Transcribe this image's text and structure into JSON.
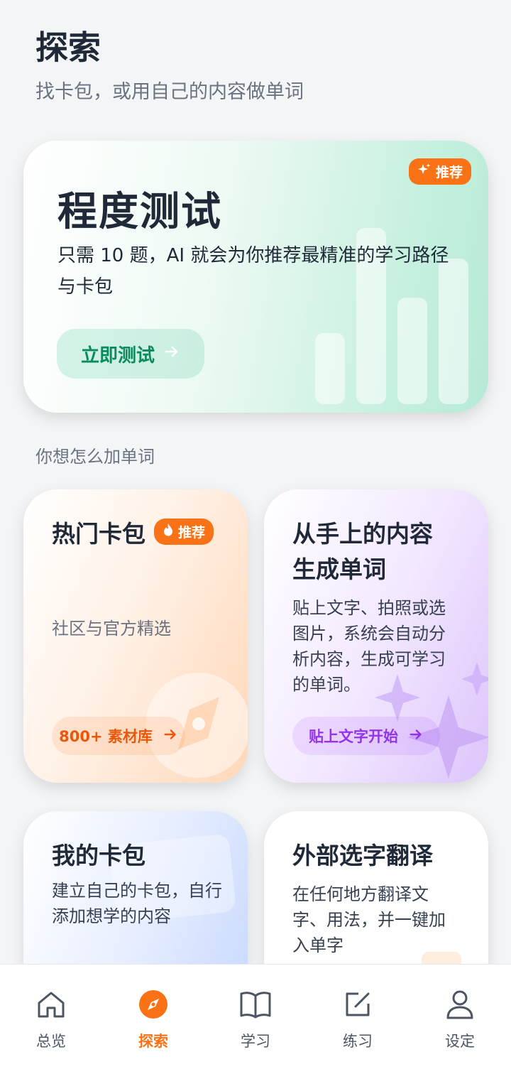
{
  "header": {
    "title": "探索",
    "subtitle": "找卡包，或用自己的内容做单词"
  },
  "hero": {
    "title": "程度测试",
    "badge": "推荐",
    "description": "只需 10 题，AI 就会为你推荐最精准的学习路径与卡包",
    "button": "立即测试"
  },
  "section_label": "你想怎么加单词",
  "cards": {
    "hot": {
      "title": "热门卡包",
      "badge": "推荐",
      "description": "社区与官方精选",
      "button": "800+ 素材库"
    },
    "generate": {
      "title_line1": "从手上的内容",
      "title_line2": "生成单词",
      "description": "贴上文字、拍照或选图片，系统会自动分析内容，生成可学习的单词。",
      "button": "贴上文字开始"
    },
    "mine": {
      "title": "我的卡包",
      "description": "建立自己的卡包，自行添加想学的内容"
    },
    "external": {
      "title": "外部选字翻译",
      "description": "在任何地方翻译文字、用法，并一键加入单字"
    }
  },
  "nav": [
    {
      "label": "总览",
      "icon": "home-icon"
    },
    {
      "label": "探索",
      "icon": "compass-icon",
      "active": true
    },
    {
      "label": "学习",
      "icon": "book-icon"
    },
    {
      "label": "练习",
      "icon": "edit-icon"
    },
    {
      "label": "设定",
      "icon": "user-icon"
    }
  ],
  "colors": {
    "accent": "#f97316",
    "green": "#0b8a5c",
    "purple": "#9333ea"
  }
}
